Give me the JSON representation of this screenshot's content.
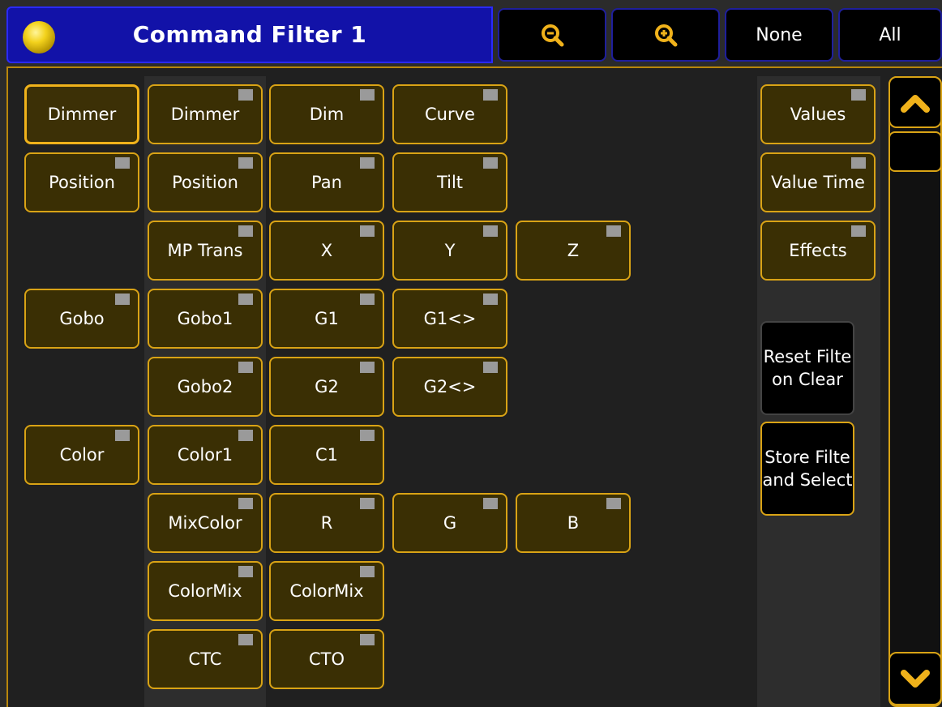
{
  "header": {
    "title": "Command Filter 1",
    "zoom_out_icon": "zoom-out-icon",
    "zoom_in_icon": "zoom-in-icon",
    "none_label": "None",
    "all_label": "All",
    "accent": "#d9a315",
    "title_bg": "#1212a8"
  },
  "groups": {
    "dimmer": "Dimmer",
    "position": "Position",
    "gobo": "Gobo",
    "color": "Color"
  },
  "attributes": {
    "dimmer": "Dimmer",
    "position": "Position",
    "mp_trans": "MP Trans",
    "gobo1": "Gobo1",
    "gobo2": "Gobo2",
    "color1": "Color1",
    "mixcolor": "MixColor",
    "colormix": "ColorMix",
    "ctc": "CTC"
  },
  "channels": {
    "dim": "Dim",
    "curve": "Curve",
    "pan": "Pan",
    "tilt": "Tilt",
    "x": "X",
    "y": "Y",
    "z": "Z",
    "g1": "G1",
    "g1_rot": "G1<>",
    "g2": "G2",
    "g2_rot": "G2<>",
    "c1": "C1",
    "r": "R",
    "g": "G",
    "b": "B",
    "colormix": "ColorMix",
    "cto": "CTO"
  },
  "side": {
    "values": "Values",
    "value_time": "Value Time",
    "effects": "Effects",
    "reset_filter": "Reset Filte\non Clear",
    "store_filter": "Store Filte\nand Select"
  },
  "scroll": {
    "up_icon": "chevron-up-icon",
    "down_icon": "chevron-down-icon"
  }
}
